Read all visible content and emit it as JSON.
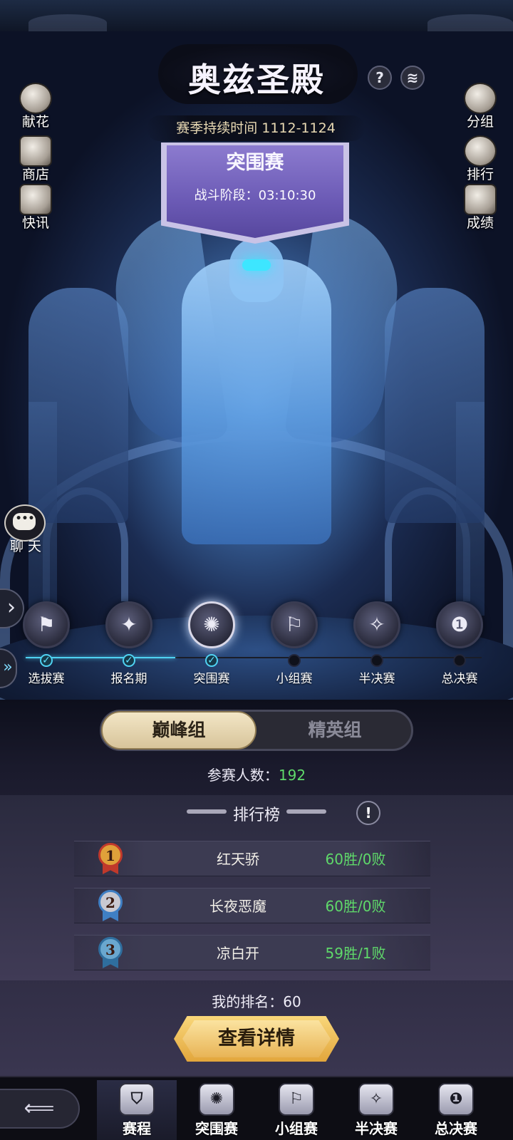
{
  "header": {
    "title": "奥兹圣殿",
    "help_icon": "question-icon",
    "help_glyph": "?",
    "notice_icon": "scroll-icon",
    "notice_glyph": "≋"
  },
  "season": {
    "label": "赛季持续时间 1112-1124"
  },
  "banner": {
    "title": "突围赛",
    "subtitle": "战斗阶段：03:10:30",
    "deco": "⊹ ‹"
  },
  "side_menu_left": [
    {
      "label": "献花",
      "icon": "rose-icon"
    },
    {
      "label": "商店",
      "icon": "cards-icon"
    },
    {
      "label": "快讯",
      "icon": "newspaper-icon"
    }
  ],
  "side_menu_right": [
    {
      "label": "分组",
      "icon": "wizard-hat-icon"
    },
    {
      "label": "排行",
      "icon": "crown-icon"
    },
    {
      "label": "成绩",
      "icon": "checklist-icon"
    }
  ],
  "chat": {
    "label": "聊 天",
    "dots": "•••"
  },
  "arrows": {
    "expand": "›",
    "double": "»"
  },
  "stages": {
    "completed_count": 3,
    "total": 6,
    "items": [
      {
        "label": "选拔赛",
        "icon": "flag-icon",
        "glyph": "⚑",
        "done": true,
        "check": "✓"
      },
      {
        "label": "报名期",
        "icon": "book-icon",
        "glyph": "✦",
        "done": true,
        "check": "✓"
      },
      {
        "label": "突围赛",
        "icon": "scroll-star-icon",
        "glyph": "✺",
        "done": true,
        "check": "✓"
      },
      {
        "label": "小组赛",
        "icon": "banner-figure-icon",
        "glyph": "⚐",
        "done": false,
        "check": ""
      },
      {
        "label": "半决赛",
        "icon": "shield-icon",
        "glyph": "✧",
        "done": false,
        "check": ""
      },
      {
        "label": "总决赛",
        "icon": "trophy-icon",
        "glyph": "❶",
        "done": false,
        "check": ""
      }
    ]
  },
  "group_toggle": {
    "selected": "巅峰组",
    "other": "精英组"
  },
  "participants": {
    "label": "参赛人数：",
    "value": "192"
  },
  "ranking": {
    "title": "排行榜",
    "info_glyph": "!",
    "rows": [
      {
        "rank": "1",
        "name": "红天骄",
        "record": "60胜/0败",
        "medal_color": "#e0a13a",
        "ribbon_color": "#c0392b"
      },
      {
        "rank": "2",
        "name": "长夜恶魔",
        "record": "60胜/0败",
        "medal_color": "#c9c9d2",
        "ribbon_color": "#3f7fc4"
      },
      {
        "rank": "3",
        "name": "凉白开",
        "record": "59胜/1败",
        "medal_color": "#6aa7cf",
        "ribbon_color": "#2f6e9e"
      }
    ]
  },
  "my_rank": {
    "label": "我的排名：",
    "value": "60"
  },
  "details_button": {
    "label": "查看详情"
  },
  "bottom_nav": {
    "back_glyph": "⟸",
    "items": [
      {
        "label": "赛程",
        "icon": "schedule-icon",
        "glyph": "⛉",
        "active": true
      },
      {
        "label": "突围赛",
        "icon": "scroll-star-icon",
        "glyph": "✺",
        "active": false
      },
      {
        "label": "小组赛",
        "icon": "banner-figure-icon",
        "glyph": "⚐",
        "active": false
      },
      {
        "label": "半决赛",
        "icon": "shield-icon",
        "glyph": "✧",
        "active": false
      },
      {
        "label": "总决赛",
        "icon": "trophy-icon",
        "glyph": "❶",
        "active": false
      }
    ]
  }
}
